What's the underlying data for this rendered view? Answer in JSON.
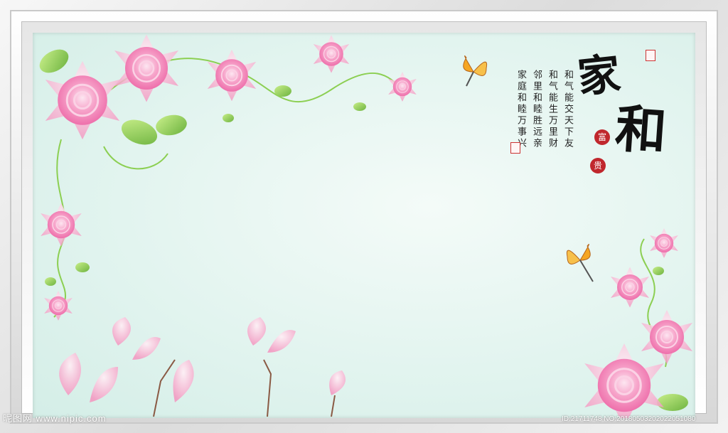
{
  "calligraphy": {
    "char_1": "家",
    "char_2": "和"
  },
  "poem": {
    "col_1": "和气能交天下友",
    "col_2": "和气能生万里财",
    "col_3": "邻里和睦胜远亲",
    "col_4": "家庭和睦万事兴"
  },
  "red_seals": {
    "fu": "富",
    "gui": "贵"
  },
  "watermark": {
    "left": "昵图网 www.nipic.com",
    "right": "ID:21711748 NO:20180503202022051080"
  },
  "colors": {
    "background": "#e2f4ef",
    "rose": "#f47fb4",
    "leaf": "#7cc34a",
    "seal_red": "#c0272d",
    "frame": "#e5e5e5"
  }
}
